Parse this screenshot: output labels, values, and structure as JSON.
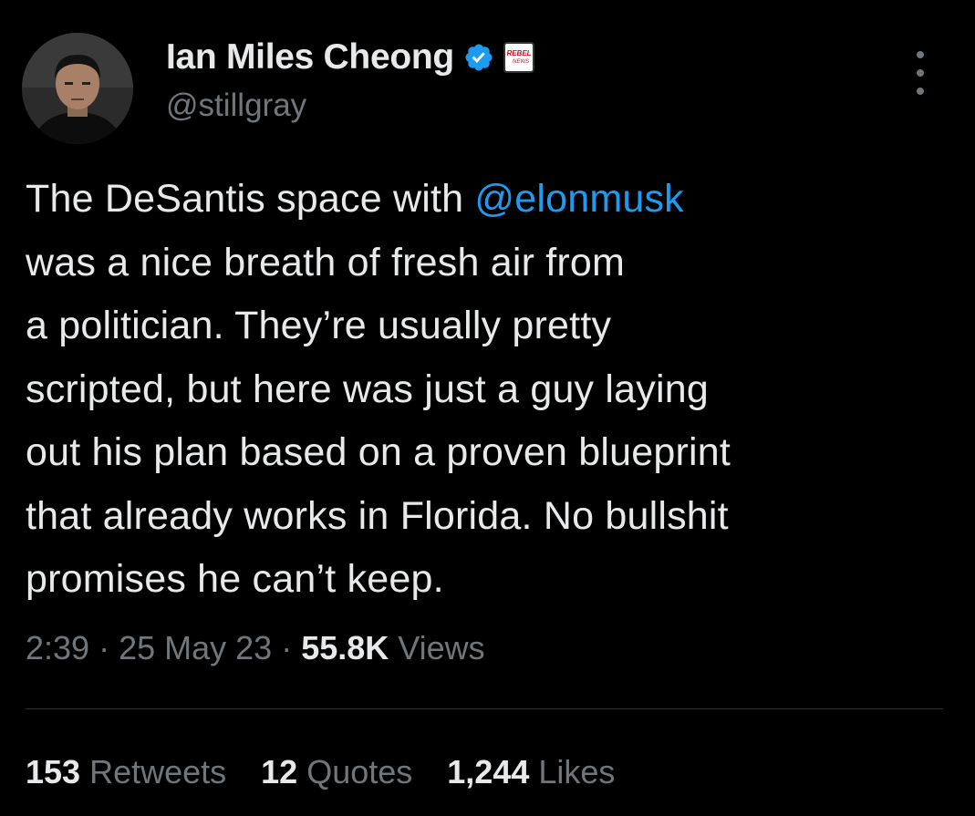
{
  "author": {
    "display_name": "Ian Miles Cheong",
    "handle": "@stillgray",
    "verified_icon": "verified-badge-icon",
    "affiliate_badge_icon": "rebel-news-badge-icon",
    "affiliate_badge_text_top": "REBEL",
    "affiliate_badge_text_bottom": "NEWS",
    "avatar": "profile-photo"
  },
  "menu": {
    "icon": "more-options-icon"
  },
  "tweet": {
    "lines": [
      {
        "before": "The DeSantis space with ",
        "mention": "@elonmusk",
        "after": ""
      },
      {
        "before": "was a nice breath of fresh air from",
        "mention": "",
        "after": ""
      },
      {
        "before": "a politician. They’re usually pretty",
        "mention": "",
        "after": ""
      },
      {
        "before": "scripted, but here was just a guy laying",
        "mention": "",
        "after": ""
      },
      {
        "before": "out his plan based on a proven blueprint",
        "mention": "",
        "after": ""
      },
      {
        "before": "that already works in Florida. No bullshit",
        "mention": "",
        "after": ""
      },
      {
        "before": "promises he can’t keep.",
        "mention": "",
        "after": ""
      }
    ]
  },
  "meta": {
    "time": "2:39",
    "sep1": " · ",
    "date": "25 May 23",
    "sep2": " · ",
    "views_count": "55.8K",
    "views_label": " Views"
  },
  "stats": {
    "retweets_count": "153",
    "retweets_label": " Retweets",
    "quotes_count": "12",
    "quotes_label": " Quotes",
    "likes_count": "1,244",
    "likes_label": " Likes"
  },
  "colors": {
    "background": "#000000",
    "text_primary": "#e7e9ea",
    "text_secondary": "#71767b",
    "accent": "#1d9bf0",
    "divider": "#2f3336"
  }
}
